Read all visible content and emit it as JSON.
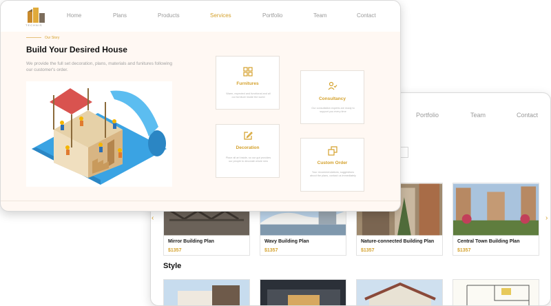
{
  "back_window": {
    "nav": [
      "Portfolio",
      "Team",
      "Contact"
    ],
    "products": [
      {
        "name": "Mirror Building Plan",
        "price": "$1357"
      },
      {
        "name": "Wavy Building Plan",
        "price": "$1357"
      },
      {
        "name": "Nature-connected Building Plan",
        "price": "$1357"
      },
      {
        "name": "Central Town Building Plan",
        "price": "$1357"
      }
    ],
    "prev_arrow": "‹",
    "next_arrow": "›",
    "style_section_title": "Style"
  },
  "front_window": {
    "logo_text": "TECHNIS",
    "nav": {
      "home": "Home",
      "plans": "Plans",
      "products": "Products",
      "services": "Services",
      "portfolio": "Portfolio",
      "team": "Team",
      "contact": "Contact"
    },
    "active_nav": "services",
    "kicker": "Our Story",
    "headline": "Build Your Desired House",
    "lead": "We provide the full set decoration, plans, materials and funitures following our customer's order.",
    "services": [
      {
        "title": "Furnitures",
        "icon": "grid-icon",
        "desc": "Warm, expected and functional and all our furniture inside the world"
      },
      {
        "title": "Consultancy",
        "icon": "user-check-icon",
        "desc": "Our consultation experts are ready to support you every time"
      },
      {
        "title": "Decoration",
        "icon": "edit-icon",
        "desc": "Place all art inside, so our gut provides our people to decorate whole new"
      },
      {
        "title": "Custom Order",
        "icon": "copy-icon",
        "desc": "Your recommendations, suggestions about the plans, contact us immediately"
      }
    ]
  },
  "colors": {
    "accent": "#d4a12c",
    "front_bg": "#fff8f3",
    "blueprint": "#3aa3e3"
  }
}
